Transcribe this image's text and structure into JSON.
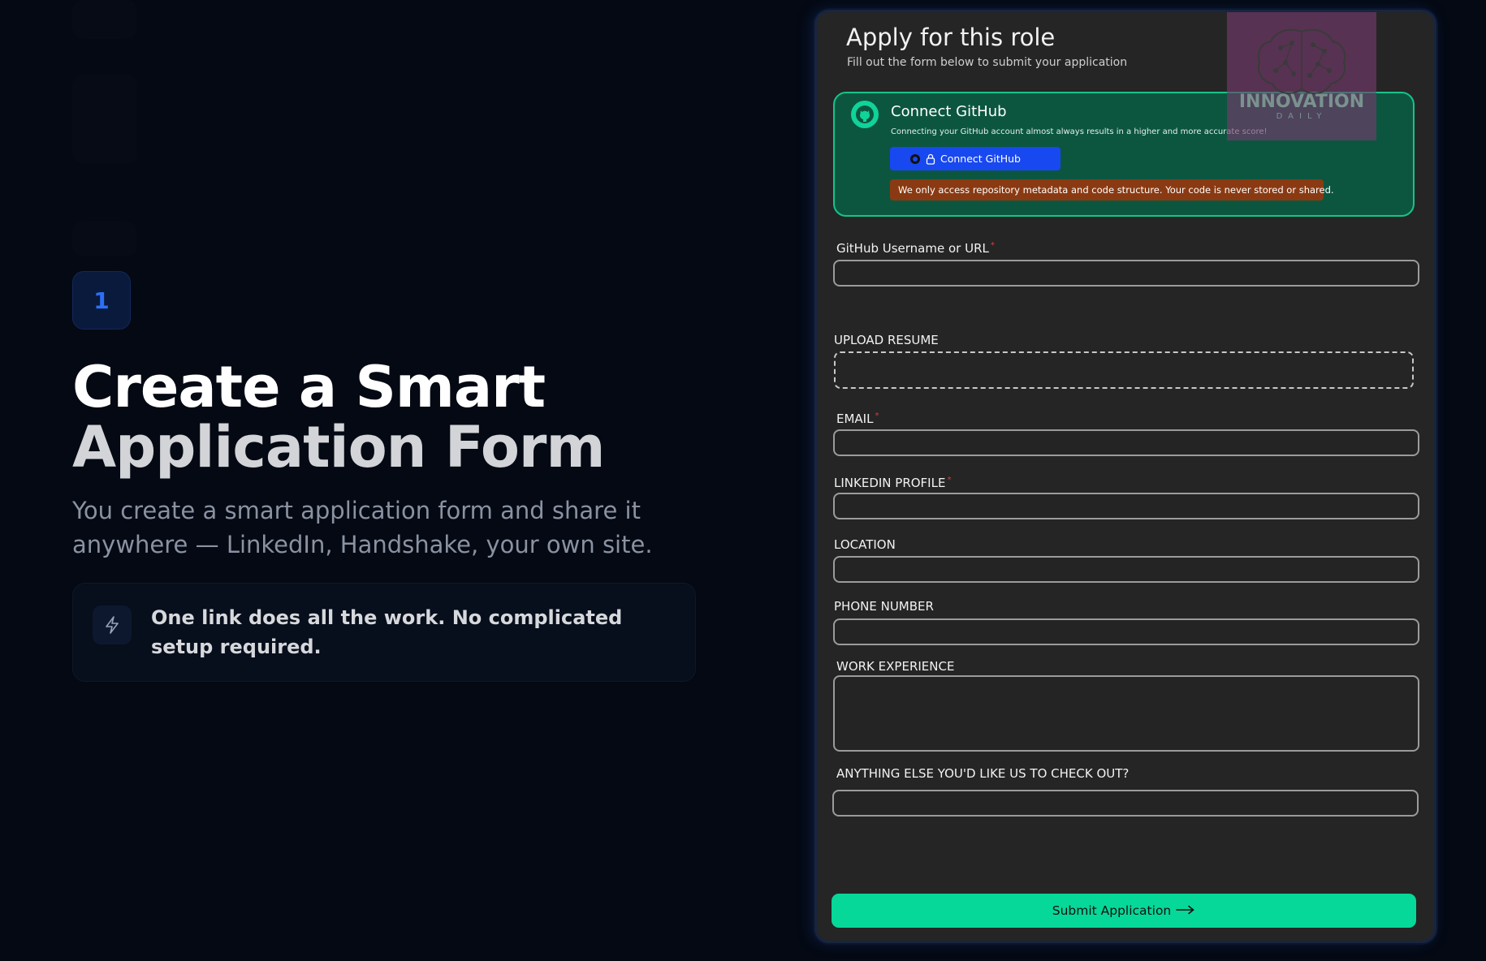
{
  "step": {
    "number": "1"
  },
  "hero": {
    "title_line1": "Create a Smart",
    "title_line2": "Application Form",
    "description": "You create a smart application form and share it anywhere — LinkedIn, Handshake, your own site."
  },
  "callout": {
    "icon": "lightning-icon",
    "text": "One link does all the work. No complicated setup required."
  },
  "form": {
    "title": "Apply for this role",
    "subtitle": "Fill out the form below to submit your application",
    "watermark": {
      "word": "INNOVATION",
      "tagline": "DAILY",
      "icon": "brain-icon"
    },
    "github": {
      "title": "Connect GitHub",
      "description": "Connecting your GitHub account almost always results in a higher and more accurate score!",
      "button_label": "Connect GitHub",
      "note": "We only access repository metadata and code structure. Your code is never stored or shared.",
      "logo_icon": "github-icon",
      "button_icons": [
        "github-icon",
        "lock-icon"
      ]
    },
    "fields": {
      "github_username": {
        "label": "GitHub Username or URL",
        "required": "*",
        "value": ""
      },
      "resume": {
        "label": "UPLOAD RESUME"
      },
      "email": {
        "label": "EMAIL",
        "required": "*",
        "value": ""
      },
      "linkedin": {
        "label": "LINKEDIN PROFILE",
        "required": "*",
        "value": ""
      },
      "location": {
        "label": "LOCATION",
        "value": ""
      },
      "phone": {
        "label": "PHONE NUMBER",
        "value": ""
      },
      "work_experience": {
        "label": "WORK EXPERIENCE",
        "value": ""
      },
      "anything_else": {
        "label": "ANYTHING ELSE YOU'D LIKE US TO CHECK OUT?",
        "value": ""
      }
    },
    "submit_label": "Submit Application",
    "submit_icon": "arrow-right-icon"
  },
  "colors": {
    "background": "#040913",
    "panel": "#252525",
    "github_card": "#0c5640",
    "github_card_border": "#14c48a",
    "connect_button": "#1848f0",
    "note": "#8a3a12",
    "submit": "#06d899",
    "step_number": "#2d6ff5"
  }
}
